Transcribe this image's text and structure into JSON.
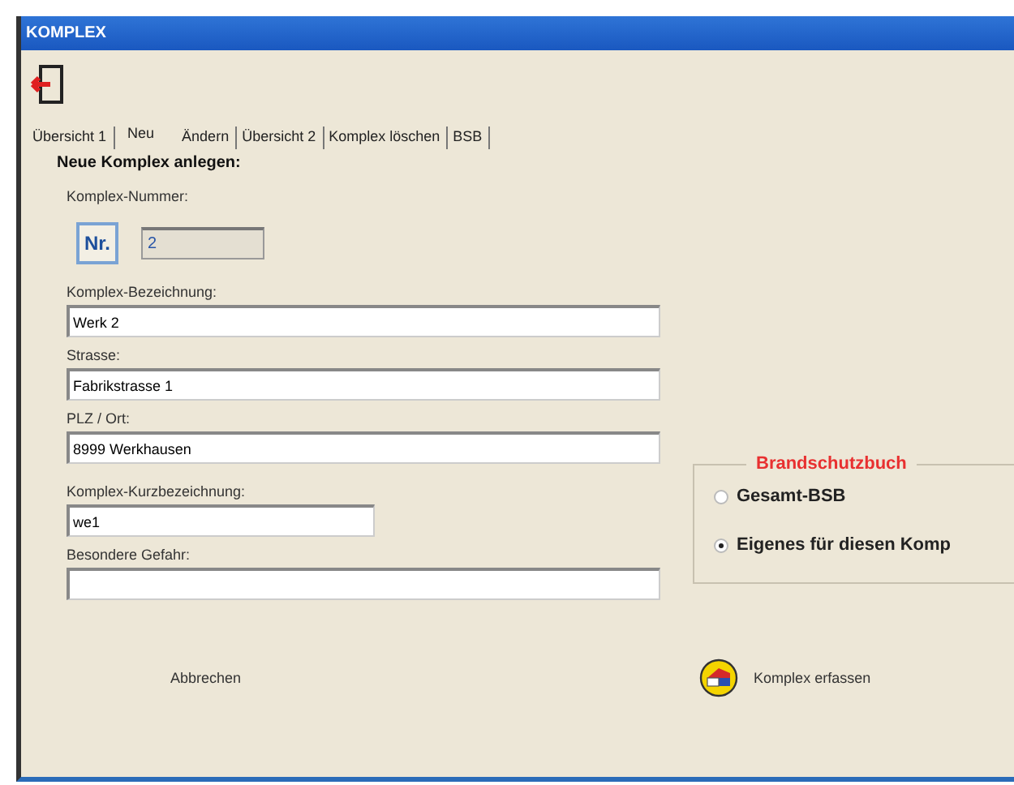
{
  "window": {
    "title": "KOMPLEX"
  },
  "tabs": [
    {
      "label": "Übersicht 1",
      "selected": false
    },
    {
      "label": "Neu",
      "selected": true
    },
    {
      "label": "Ändern",
      "selected": false
    },
    {
      "label": "Übersicht 2",
      "selected": false
    },
    {
      "label": "Komplex löschen",
      "selected": false
    },
    {
      "label": "BSB",
      "selected": false
    }
  ],
  "form": {
    "heading": "Neue Komplex anlegen:",
    "number": {
      "label": "Komplex-Nummer:",
      "badge": "Nr.",
      "value": "2",
      "disabled": true
    },
    "fields": [
      {
        "label": "Komplex-Bezeichnung:",
        "value": "Werk 2",
        "kind": "wide"
      },
      {
        "label": "Strasse:",
        "value": "Fabrikstrasse 1",
        "kind": "wide"
      },
      {
        "label": "PLZ / Ort:",
        "value": "8999 Werkhausen",
        "kind": "wide"
      },
      {
        "label": "Komplex-Kurzbezeichnung:",
        "value": "we1",
        "kind": "short"
      },
      {
        "label": "Besondere Gefahr:",
        "kind": "wide"
      }
    ]
  },
  "brandschutzbuch": {
    "title": "Brandschutzbuch",
    "options": [
      {
        "label": "Gesamt-BSB",
        "selected": false
      },
      {
        "label": "Eigenes für diesen Komp",
        "selected": true
      }
    ]
  },
  "buttons": {
    "cancel": "Abbrechen",
    "submit": "Komplex erfassen"
  }
}
